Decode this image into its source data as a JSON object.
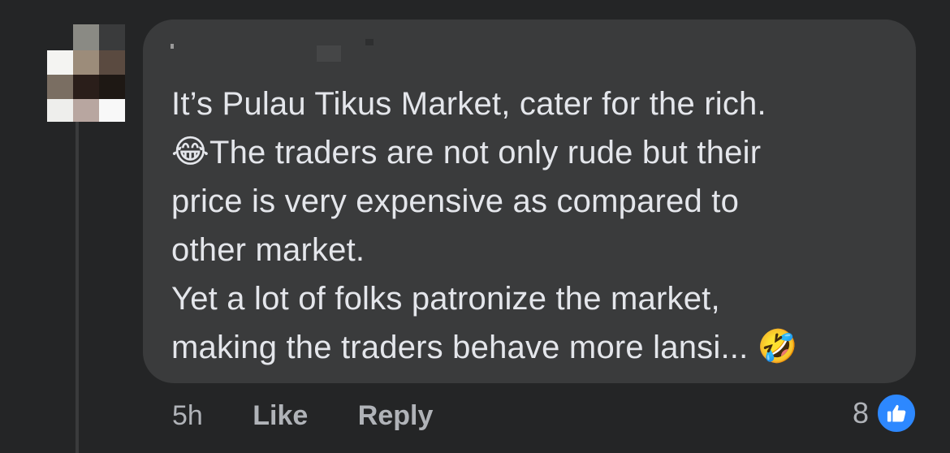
{
  "comment": {
    "lines": [
      "It’s Pulau Tikus Market, cater for the rich.",
      "The traders are not only rude but their",
      "price is very expensive as compared to",
      "other market.",
      "Yet a lot of folks patronize the market,",
      "making the traders behave more lansi..."
    ],
    "emoji_tears_of_joy": "😂",
    "emoji_rofl": "🤣"
  },
  "actions": {
    "time": "5h",
    "like_label": "Like",
    "reply_label": "Reply"
  },
  "reactions": {
    "count": "8",
    "icon": "thumbs-up-icon"
  },
  "colors": {
    "background": "#242526",
    "bubble": "#3a3b3c",
    "text": "#e4e6eb",
    "secondary_text": "#b0b3b8",
    "like_blue": "#2d88ff"
  }
}
